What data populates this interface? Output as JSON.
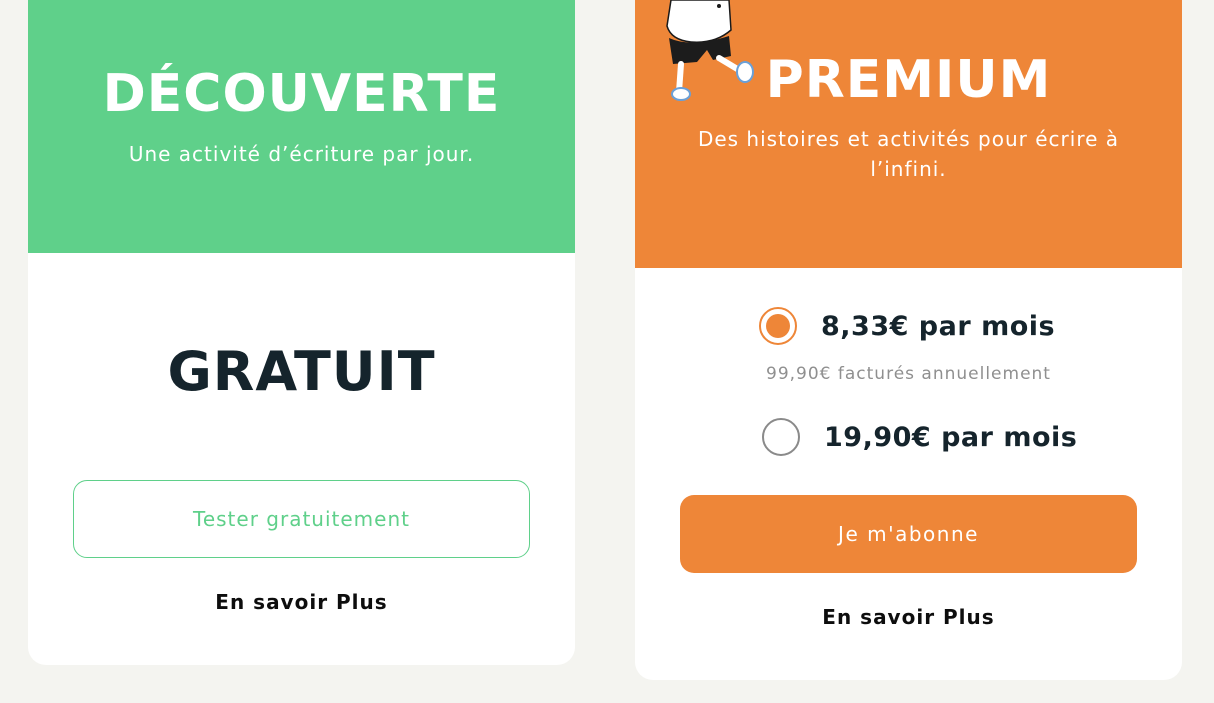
{
  "colors": {
    "page_bg": "#f4f4f0",
    "free_accent": "#5fd08a",
    "premium_accent": "#ee8638",
    "dark_text": "#15242c"
  },
  "free_plan": {
    "title": "DÉCOUVERTE",
    "subtitle": "Une activité d’écriture par jour.",
    "price": "GRATUIT",
    "cta_label": "Tester gratuitement",
    "learn_more": "En savoir Plus"
  },
  "premium_plan": {
    "title": "PREMIUM",
    "subtitle": "Des histoires et activités pour écrire à l’infini.",
    "mascot_icon": "mascot-illustration",
    "options": [
      {
        "label": "8,33€ par mois",
        "selected": true
      },
      {
        "label": "19,90€ par mois",
        "selected": false
      }
    ],
    "billing_note": "99,90€ facturés annuellement",
    "cta_label": "Je m'abonne",
    "learn_more": "En savoir Plus"
  }
}
